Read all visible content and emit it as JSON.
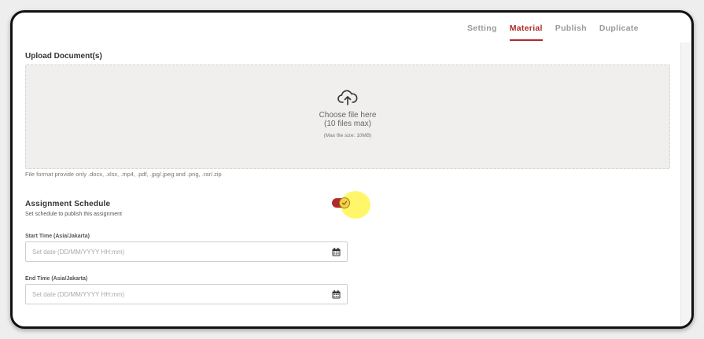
{
  "tabs": [
    {
      "label": "Setting",
      "active": false
    },
    {
      "label": "Material",
      "active": true
    },
    {
      "label": "Publish",
      "active": false
    },
    {
      "label": "Duplicate",
      "active": false
    }
  ],
  "upload": {
    "title": "Upload Document(s)",
    "icon": "cloud-upload-icon",
    "choose_text": "Choose file here",
    "limit_text": "(10 files max)",
    "size_text": "(Max file size: 10MB)",
    "format_note": "File format provide only .docx, .xlsx, .mp4, .pdf, .jpg/.jpeg and .png, .rar/.zip"
  },
  "schedule": {
    "title": "Assignment Schedule",
    "subtitle": "Set schedule to publish this assignment",
    "toggle_on": true,
    "start_label": "Start Time (Asia/Jakarta)",
    "start_placeholder": "Set date (DD/MM/YYYY HH:mm)",
    "end_label": "End Time (Asia/Jakarta)",
    "end_placeholder": "Set date (DD/MM/YYYY HH:mm)",
    "calendar_icon": "calendar-icon"
  },
  "colors": {
    "accent": "#b02a2a",
    "highlight": "#fff550"
  }
}
